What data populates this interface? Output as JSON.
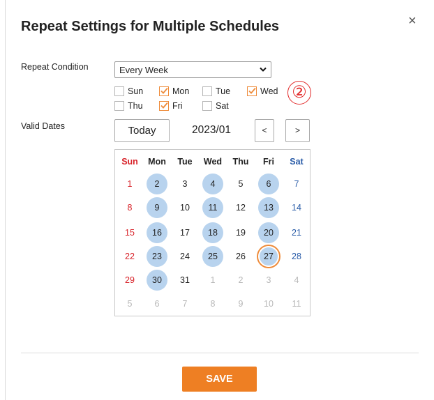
{
  "dialog": {
    "title": "Repeat Settings for Multiple Schedules",
    "close_icon": "×"
  },
  "repeat": {
    "label": "Repeat Condition",
    "selected": "Every Week",
    "weekdays": [
      {
        "label": "Sun",
        "checked": false
      },
      {
        "label": "Mon",
        "checked": true
      },
      {
        "label": "Tue",
        "checked": false
      },
      {
        "label": "Wed",
        "checked": true
      },
      {
        "label": "Thu",
        "checked": false
      },
      {
        "label": "Fri",
        "checked": true
      },
      {
        "label": "Sat",
        "checked": false
      }
    ]
  },
  "annotation": "②",
  "valid_dates": {
    "label": "Valid Dates",
    "today_label": "Today",
    "month": "2023/01",
    "prev_label": "<",
    "next_label": ">"
  },
  "calendar": {
    "weekday_headers": [
      "Sun",
      "Mon",
      "Tue",
      "Wed",
      "Thu",
      "Fri",
      "Sat"
    ],
    "weeks": [
      [
        {
          "d": "1"
        },
        {
          "d": "2",
          "sel": true
        },
        {
          "d": "3"
        },
        {
          "d": "4",
          "sel": true
        },
        {
          "d": "5"
        },
        {
          "d": "6",
          "sel": true
        },
        {
          "d": "7"
        }
      ],
      [
        {
          "d": "8"
        },
        {
          "d": "9",
          "sel": true
        },
        {
          "d": "10"
        },
        {
          "d": "11",
          "sel": true
        },
        {
          "d": "12"
        },
        {
          "d": "13",
          "sel": true
        },
        {
          "d": "14"
        }
      ],
      [
        {
          "d": "15"
        },
        {
          "d": "16",
          "sel": true
        },
        {
          "d": "17"
        },
        {
          "d": "18",
          "sel": true
        },
        {
          "d": "19"
        },
        {
          "d": "20",
          "sel": true
        },
        {
          "d": "21"
        }
      ],
      [
        {
          "d": "22"
        },
        {
          "d": "23",
          "sel": true
        },
        {
          "d": "24"
        },
        {
          "d": "25",
          "sel": true
        },
        {
          "d": "26"
        },
        {
          "d": "27",
          "sel": true,
          "today": true
        },
        {
          "d": "28"
        }
      ],
      [
        {
          "d": "29"
        },
        {
          "d": "30",
          "sel": true
        },
        {
          "d": "31"
        },
        {
          "d": "1",
          "dim": true
        },
        {
          "d": "2",
          "dim": true
        },
        {
          "d": "3",
          "dim": true
        },
        {
          "d": "4",
          "dim": true
        }
      ],
      [
        {
          "d": "5",
          "dim": true
        },
        {
          "d": "6",
          "dim": true
        },
        {
          "d": "7",
          "dim": true
        },
        {
          "d": "8",
          "dim": true
        },
        {
          "d": "9",
          "dim": true
        },
        {
          "d": "10",
          "dim": true
        },
        {
          "d": "11",
          "dim": true
        }
      ]
    ]
  },
  "footer": {
    "save_label": "SAVE"
  },
  "colors": {
    "accent": "#ee7f23",
    "selected_day": "#b8d3ee",
    "sunday": "#d8232a",
    "saturday": "#2a5ca8",
    "annotation": "#e22a2a"
  }
}
